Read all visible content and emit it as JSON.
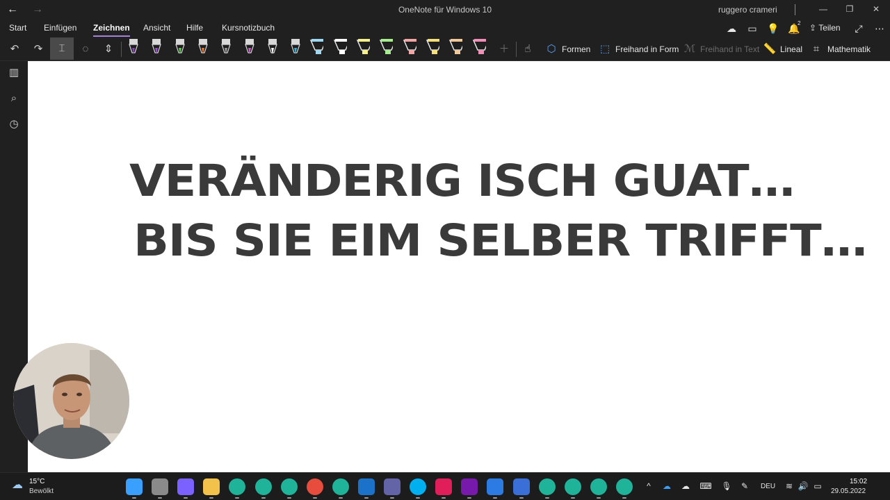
{
  "window": {
    "title": "OneNote für Windows 10",
    "user": "ruggero crameri"
  },
  "menu": {
    "items": [
      "Start",
      "Einfügen",
      "Zeichnen",
      "Ansicht",
      "Hilfe",
      "Kursnotizbuch"
    ],
    "active": "Zeichnen",
    "notification_count": "2",
    "share_label": "Teilen"
  },
  "toolbar": {
    "pens": [
      {
        "icon": "pen-icon",
        "color": "#8c3fbf"
      },
      {
        "icon": "pen-icon",
        "color": "#9b4fd6"
      },
      {
        "icon": "pen-icon",
        "color": "#5bd04a"
      },
      {
        "icon": "pen-icon",
        "color": "#f07a2a"
      },
      {
        "icon": "pen-icon",
        "color": "#9a9a9a"
      },
      {
        "icon": "pen-icon",
        "color": "#d35bd0"
      },
      {
        "icon": "pen-icon",
        "color": "#ffffff"
      },
      {
        "icon": "pen-icon",
        "color": "#2fb5e0"
      },
      {
        "icon": "highlighter-icon",
        "color": "#9fd7f0"
      },
      {
        "icon": "highlighter-icon",
        "color": "#ffffff"
      },
      {
        "icon": "highlighter-icon",
        "color": "#f5f08a"
      },
      {
        "icon": "highlighter-icon",
        "color": "#a7ec8e"
      },
      {
        "icon": "highlighter-icon",
        "color": "#f2a7a7"
      },
      {
        "icon": "highlighter-icon",
        "color": "#f5e07a"
      },
      {
        "icon": "highlighter-icon",
        "color": "#f0c89a"
      },
      {
        "icon": "highlighter-icon",
        "color": "#f08fb8"
      }
    ],
    "shapes_label": "Formen",
    "ink_to_shape_label": "Freihand in Form",
    "ink_to_text_label": "Freihand in Text",
    "ruler_label": "Lineal",
    "math_label": "Mathematik"
  },
  "canvas": {
    "line1": "VERÄNDERIG ISCH GUAT…",
    "line2": "BIS SIE EIM SELBER TRIFFT…"
  },
  "taskbar": {
    "weather_temp": "15°C",
    "weather_desc": "Bewölkt",
    "apps": [
      {
        "name": "start-icon",
        "color": "#3aa0ff"
      },
      {
        "name": "task-view-icon",
        "color": "#8a8a8a"
      },
      {
        "name": "teams-chat-icon",
        "color": "#7b61ff"
      },
      {
        "name": "file-explorer-icon",
        "color": "#f2c24a"
      },
      {
        "name": "edge-icon",
        "color": "#1fb39a"
      },
      {
        "name": "edge-icon",
        "color": "#1fb39a"
      },
      {
        "name": "edge-icon",
        "color": "#1fb39a"
      },
      {
        "name": "chrome-icon",
        "color": "#e74c3c"
      },
      {
        "name": "edge-icon",
        "color": "#1fb39a"
      },
      {
        "name": "outlook-icon",
        "color": "#1a73c8"
      },
      {
        "name": "teams-icon",
        "color": "#6264a7"
      },
      {
        "name": "skype-icon",
        "color": "#00aff0"
      },
      {
        "name": "slack-icon",
        "color": "#e01e5a"
      },
      {
        "name": "onenote-icon",
        "color": "#7719aa"
      },
      {
        "name": "whiteboard-icon",
        "color": "#2c7be5"
      },
      {
        "name": "app-icon",
        "color": "#3a6fd8"
      },
      {
        "name": "edge-icon",
        "color": "#1fb39a"
      },
      {
        "name": "edge-icon",
        "color": "#1fb39a"
      },
      {
        "name": "edge-icon",
        "color": "#1fb39a"
      },
      {
        "name": "edge-icon",
        "color": "#1fb39a"
      }
    ],
    "language": "DEU",
    "time": "15:02",
    "date": "29.05.2022"
  }
}
